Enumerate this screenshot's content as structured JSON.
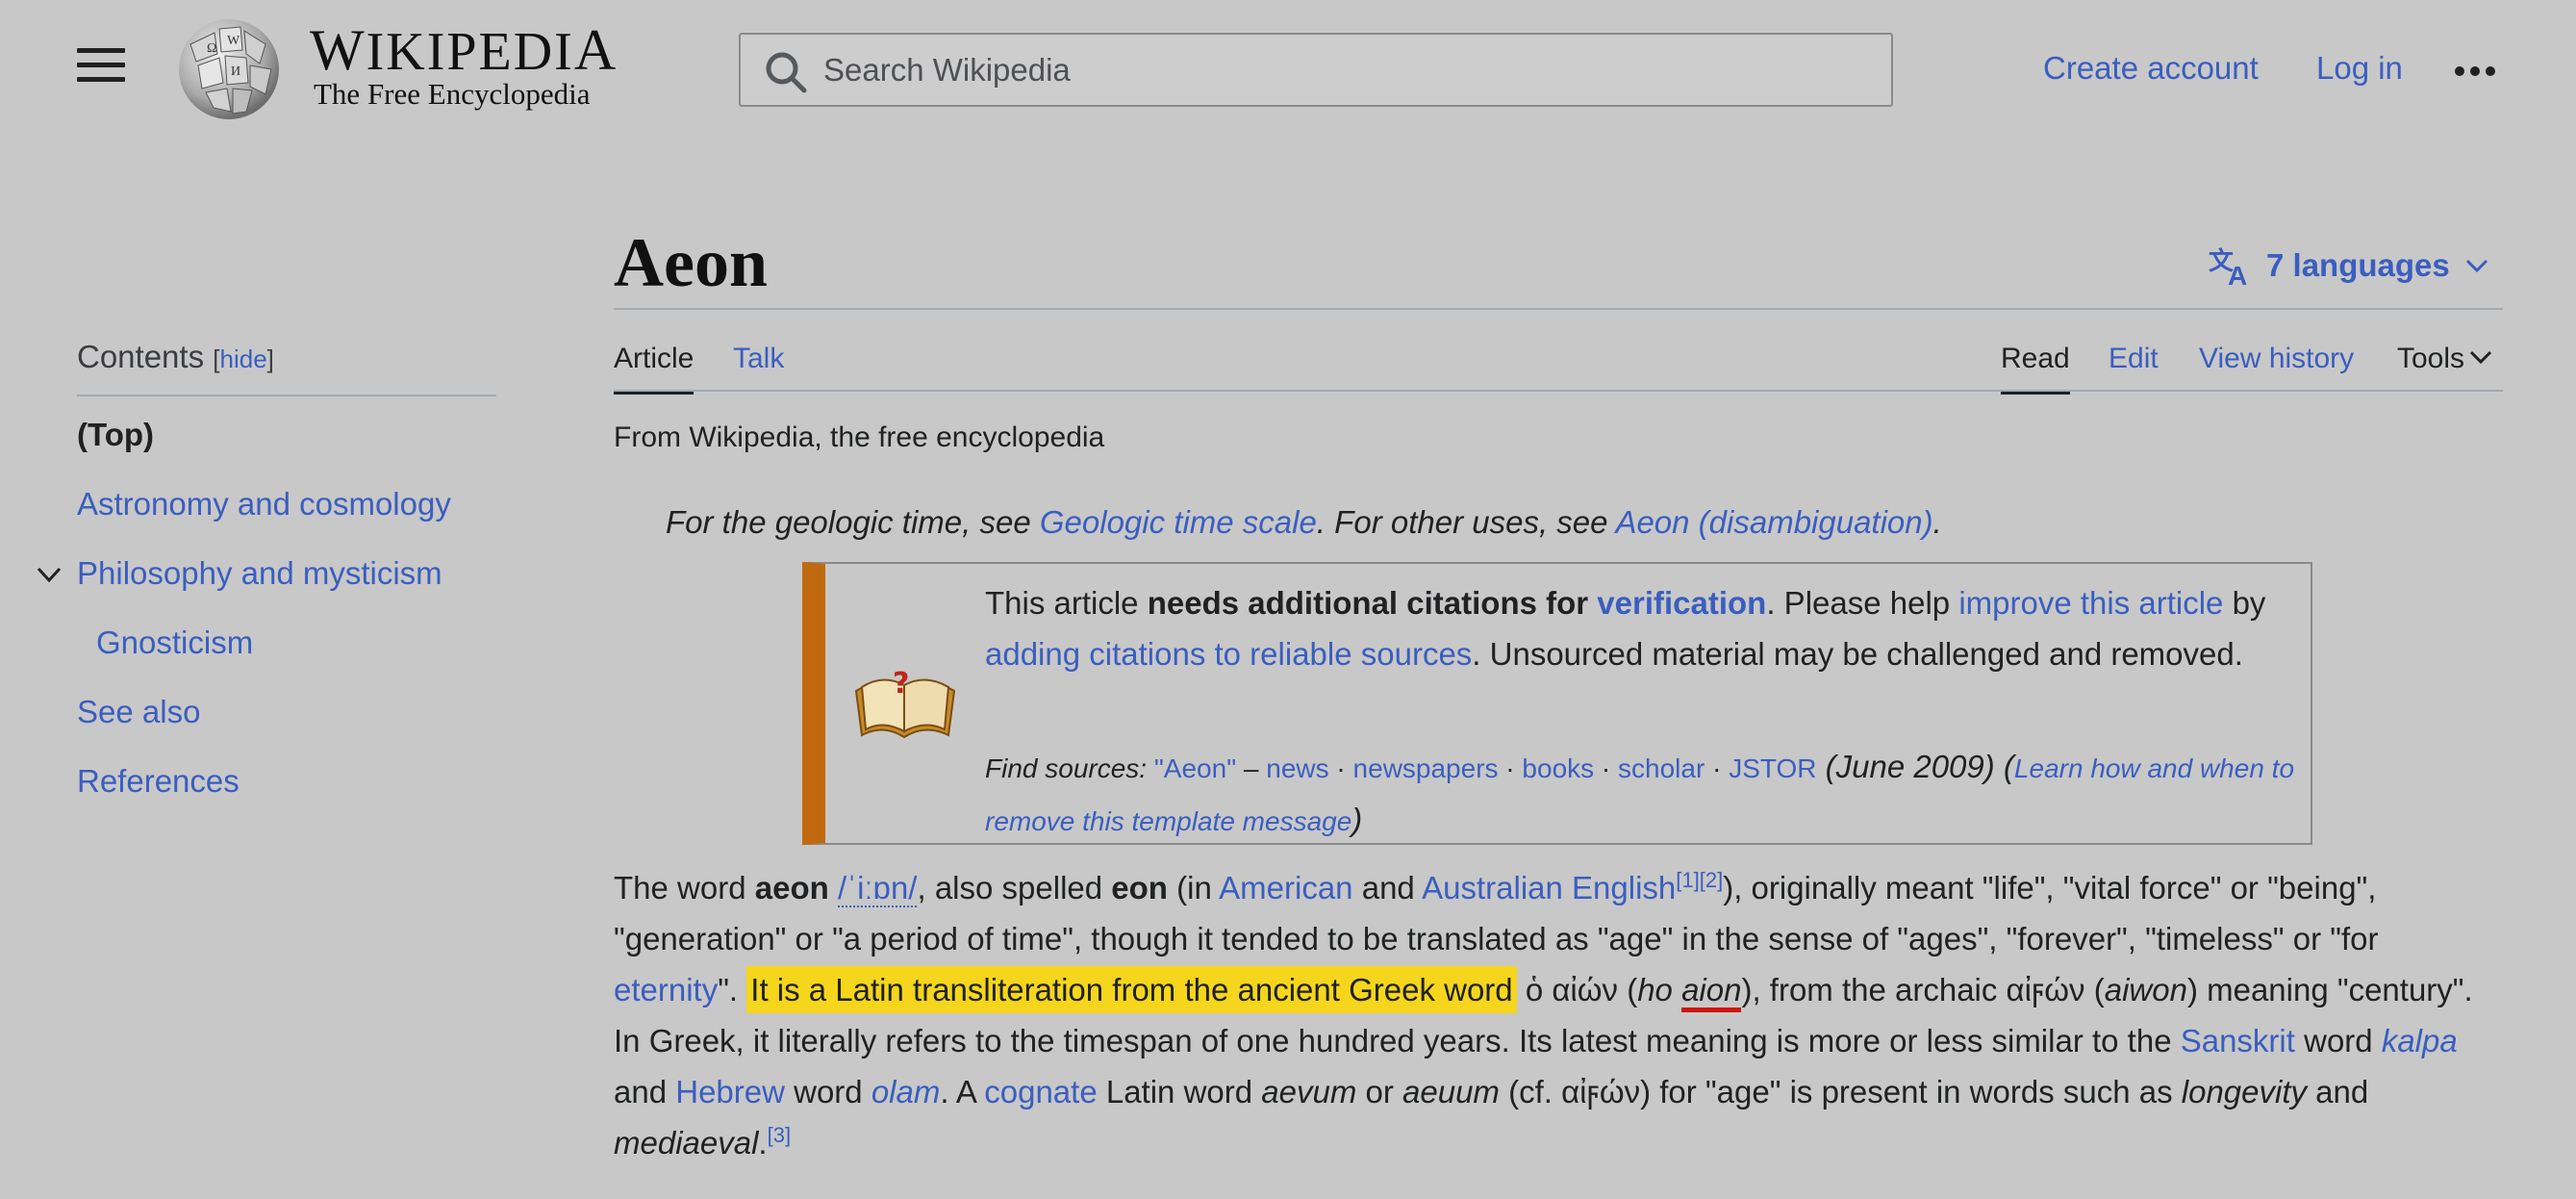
{
  "header": {
    "menu_icon": "hamburger-menu-icon",
    "logo": {
      "wordmark_first": "W",
      "wordmark_mid": "IKIPEDI",
      "wordmark_last": "A",
      "tagline": "The Free Encyclopedia"
    },
    "search": {
      "placeholder": "Search Wikipedia",
      "value": ""
    },
    "create_account": "Create account",
    "log_in": "Log in",
    "more_icon": "ellipsis-icon"
  },
  "toc": {
    "heading": "Contents",
    "hide_open": "[",
    "hide_label": "hide",
    "hide_close": "]",
    "items": [
      {
        "label": "(Top)"
      },
      {
        "label": "Astronomy and cosmology"
      },
      {
        "label": "Philosophy and mysticism"
      },
      {
        "label": "Gnosticism"
      },
      {
        "label": "See also"
      },
      {
        "label": "References"
      }
    ]
  },
  "article": {
    "title": "Aeon",
    "languages": "7 languages",
    "tabs": {
      "article": "Article",
      "talk": "Talk",
      "read": "Read",
      "edit": "Edit",
      "view_history": "View history",
      "tools": "Tools"
    },
    "from": "From Wikipedia, the free encyclopedia",
    "hatnote": {
      "t1": "For the geologic time, see ",
      "l1": "Geologic time scale",
      "t2": ". For other uses, see ",
      "l2": "Aeon (disambiguation)",
      "t3": "."
    },
    "ambox": {
      "t1": "This article ",
      "b1": "needs additional citations for ",
      "l1": "verification",
      "t2": ". Please help ",
      "l2": "improve this article",
      "t3": " by ",
      "l3": "adding citations to reliable sources",
      "t4": ". Unsourced material may be challenged and removed.",
      "find": "Find sources: ",
      "q": "\"Aeon\"",
      "dash": " – ",
      "news": "news",
      "sep": " · ",
      "newspapers": "newspapers",
      "books": "books",
      "scholar": "scholar",
      "jstor": "JSTOR",
      "date": " (June 2009) (",
      "learn": "Learn how and when to remove this template message",
      "close": ")"
    },
    "body": {
      "s1": "The word ",
      "aeon": "aeon",
      "ipa": "/ˈiːɒn/",
      "s2": ", also spelled ",
      "eon": "eon",
      "s3": " (in ",
      "american": "American",
      "s4": " and ",
      "australian": "Australian English",
      "ref12": "[1][2]",
      "s5": "), originally meant \"life\", \"vital force\" or \"being\", \"generation\" or \"a period of time\", though it tended to be translated as \"age\" in the sense of \"ages\", \"forever\", \"timeless\" or \"for ",
      "eternity": "eternity",
      "s6": "\". ",
      "highlight": "It is a Latin transliteration from the ancient Greek word",
      "s7": " ὁ αἰών (",
      "ho": "ho",
      "s8": " ",
      "aion": "aion",
      "s9": "), from the archaic αἰϝών (",
      "aiwon": "aiwon",
      "s10": ") meaning \"century\". In Greek, it literally refers to the timespan of one hundred years. Its latest meaning is more or less similar to the ",
      "sanskrit": "Sanskrit",
      "s11": " word ",
      "kalpa": "kalpa",
      "s12": " and ",
      "hebrew": "Hebrew",
      "s13": " word ",
      "olam": "olam",
      "s14": ". A ",
      "cognate": "cognate",
      "s15": " Latin word ",
      "aevum": "aevum",
      "s16": " or ",
      "aeuum": "aeuum",
      "s17": " (cf. αἰϝών) for \"age\" is present in words such as ",
      "longevity": "longevity",
      "s18": " and ",
      "mediaeval": "mediaeval",
      "s19": ".",
      "ref3": "[3]"
    }
  },
  "colors": {
    "link": "#3a5ec0",
    "highlight": "#f5d61c",
    "ambox_bar": "#c0690f",
    "underline_mark": "#d0140c"
  }
}
